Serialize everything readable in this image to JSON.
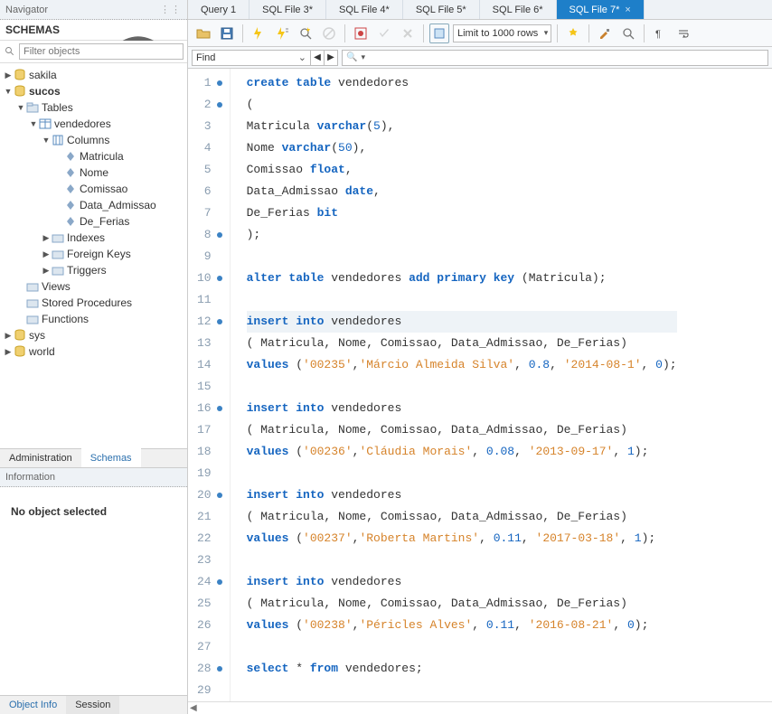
{
  "sidebar": {
    "nav_title": "Navigator",
    "schemas_label": "SCHEMAS",
    "filter_placeholder": "Filter objects",
    "info_title": "Information",
    "no_object": "No object selected",
    "bottom_tabs": {
      "admin": "Administration",
      "schemas": "Schemas",
      "object_info": "Object Info",
      "session": "Session"
    },
    "tree": {
      "sakila": "sakila",
      "sucos": "sucos",
      "tables": "Tables",
      "vendedores": "vendedores",
      "columns": "Columns",
      "cols": [
        "Matricula",
        "Nome",
        "Comissao",
        "Data_Admissao",
        "De_Ferias"
      ],
      "indexes": "Indexes",
      "foreign_keys": "Foreign Keys",
      "triggers": "Triggers",
      "views": "Views",
      "stored_procedures": "Stored Procedures",
      "functions": "Functions",
      "sys": "sys",
      "world": "world"
    }
  },
  "tabs": [
    {
      "label": "Query 1"
    },
    {
      "label": "SQL File 3*"
    },
    {
      "label": "SQL File 4*"
    },
    {
      "label": "SQL File 5*"
    },
    {
      "label": "SQL File 6*"
    },
    {
      "label": "SQL File 7*"
    }
  ],
  "toolbar": {
    "limit_label": "Limit to 1000 rows"
  },
  "findbar": {
    "find_label": "Find"
  },
  "code": {
    "lines": [
      {
        "n": 1,
        "dot": true,
        "seg": [
          [
            "kw",
            "create table"
          ],
          [
            "pn",
            " "
          ],
          [
            "ident",
            "vendedores"
          ]
        ]
      },
      {
        "n": 2,
        "dot": true,
        "seg": [
          [
            "pn",
            "("
          ]
        ]
      },
      {
        "n": 3,
        "dot": false,
        "seg": [
          [
            "ident",
            "Matricula "
          ],
          [
            "type",
            "varchar"
          ],
          [
            "pn",
            "("
          ],
          [
            "num",
            "5"
          ],
          [
            "pn",
            "),"
          ]
        ]
      },
      {
        "n": 4,
        "dot": false,
        "seg": [
          [
            "ident",
            "Nome "
          ],
          [
            "type",
            "varchar"
          ],
          [
            "pn",
            "("
          ],
          [
            "num",
            "50"
          ],
          [
            "pn",
            "),"
          ]
        ]
      },
      {
        "n": 5,
        "dot": false,
        "seg": [
          [
            "ident",
            "Comissao "
          ],
          [
            "type",
            "float"
          ],
          [
            "pn",
            ","
          ]
        ]
      },
      {
        "n": 6,
        "dot": false,
        "seg": [
          [
            "ident",
            "Data_Admissao "
          ],
          [
            "type",
            "date"
          ],
          [
            "pn",
            ","
          ]
        ]
      },
      {
        "n": 7,
        "dot": false,
        "seg": [
          [
            "ident",
            "De_Ferias "
          ],
          [
            "type",
            "bit"
          ]
        ]
      },
      {
        "n": 8,
        "dot": true,
        "seg": [
          [
            "pn",
            ");"
          ]
        ]
      },
      {
        "n": 9,
        "dot": false,
        "seg": []
      },
      {
        "n": 10,
        "dot": true,
        "seg": [
          [
            "kw",
            "alter table"
          ],
          [
            "pn",
            " "
          ],
          [
            "ident",
            "vendedores "
          ],
          [
            "kw",
            "add primary key"
          ],
          [
            "pn",
            " (Matricula);"
          ]
        ]
      },
      {
        "n": 11,
        "dot": false,
        "seg": []
      },
      {
        "n": 12,
        "dot": true,
        "hl": true,
        "seg": [
          [
            "kw",
            "insert into"
          ],
          [
            "pn",
            " "
          ],
          [
            "ident",
            "vendedores"
          ]
        ]
      },
      {
        "n": 13,
        "dot": false,
        "seg": [
          [
            "pn",
            "( Matricula, Nome, Comissao, Data_Admissao, De_Ferias)"
          ]
        ]
      },
      {
        "n": 14,
        "dot": false,
        "seg": [
          [
            "kw",
            "values"
          ],
          [
            "pn",
            " ("
          ],
          [
            "str",
            "'00235'"
          ],
          [
            "pn",
            ","
          ],
          [
            "str",
            "'Márcio Almeida Silva'"
          ],
          [
            "pn",
            ", "
          ],
          [
            "num",
            "0.8"
          ],
          [
            "pn",
            ", "
          ],
          [
            "str",
            "'2014-08-1'"
          ],
          [
            "pn",
            ", "
          ],
          [
            "num",
            "0"
          ],
          [
            "pn",
            ");"
          ]
        ]
      },
      {
        "n": 15,
        "dot": false,
        "seg": []
      },
      {
        "n": 16,
        "dot": true,
        "seg": [
          [
            "kw",
            "insert into"
          ],
          [
            "pn",
            " "
          ],
          [
            "ident",
            "vendedores"
          ]
        ]
      },
      {
        "n": 17,
        "dot": false,
        "seg": [
          [
            "pn",
            "( Matricula, Nome, Comissao, Data_Admissao, De_Ferias)"
          ]
        ]
      },
      {
        "n": 18,
        "dot": false,
        "seg": [
          [
            "kw",
            "values"
          ],
          [
            "pn",
            " ("
          ],
          [
            "str",
            "'00236'"
          ],
          [
            "pn",
            ","
          ],
          [
            "str",
            "'Cláudia Morais'"
          ],
          [
            "pn",
            ", "
          ],
          [
            "num",
            "0.08"
          ],
          [
            "pn",
            ", "
          ],
          [
            "str",
            "'2013-09-17'"
          ],
          [
            "pn",
            ", "
          ],
          [
            "num",
            "1"
          ],
          [
            "pn",
            ");"
          ]
        ]
      },
      {
        "n": 19,
        "dot": false,
        "seg": []
      },
      {
        "n": 20,
        "dot": true,
        "seg": [
          [
            "kw",
            "insert into"
          ],
          [
            "pn",
            " "
          ],
          [
            "ident",
            "vendedores"
          ]
        ]
      },
      {
        "n": 21,
        "dot": false,
        "seg": [
          [
            "pn",
            "( Matricula, Nome, Comissao, Data_Admissao, De_Ferias)"
          ]
        ]
      },
      {
        "n": 22,
        "dot": false,
        "seg": [
          [
            "kw",
            "values"
          ],
          [
            "pn",
            " ("
          ],
          [
            "str",
            "'00237'"
          ],
          [
            "pn",
            ","
          ],
          [
            "str",
            "'Roberta Martins'"
          ],
          [
            "pn",
            ", "
          ],
          [
            "num",
            "0.11"
          ],
          [
            "pn",
            ", "
          ],
          [
            "str",
            "'2017-03-18'"
          ],
          [
            "pn",
            ", "
          ],
          [
            "num",
            "1"
          ],
          [
            "pn",
            ");"
          ]
        ]
      },
      {
        "n": 23,
        "dot": false,
        "seg": []
      },
      {
        "n": 24,
        "dot": true,
        "seg": [
          [
            "kw",
            "insert into"
          ],
          [
            "pn",
            " "
          ],
          [
            "ident",
            "vendedores"
          ]
        ]
      },
      {
        "n": 25,
        "dot": false,
        "seg": [
          [
            "pn",
            "( Matricula, Nome, Comissao, Data_Admissao, De_Ferias)"
          ]
        ]
      },
      {
        "n": 26,
        "dot": false,
        "seg": [
          [
            "kw",
            "values"
          ],
          [
            "pn",
            " ("
          ],
          [
            "str",
            "'00238'"
          ],
          [
            "pn",
            ","
          ],
          [
            "str",
            "'Péricles Alves'"
          ],
          [
            "pn",
            ", "
          ],
          [
            "num",
            "0.11"
          ],
          [
            "pn",
            ", "
          ],
          [
            "str",
            "'2016-08-21'"
          ],
          [
            "pn",
            ", "
          ],
          [
            "num",
            "0"
          ],
          [
            "pn",
            ");"
          ]
        ]
      },
      {
        "n": 27,
        "dot": false,
        "seg": []
      },
      {
        "n": 28,
        "dot": true,
        "seg": [
          [
            "kw",
            "select"
          ],
          [
            "pn",
            " * "
          ],
          [
            "kw",
            "from"
          ],
          [
            "pn",
            " "
          ],
          [
            "ident",
            "vendedores"
          ],
          [
            "pn",
            ";"
          ]
        ]
      },
      {
        "n": 29,
        "dot": false,
        "seg": []
      }
    ]
  }
}
